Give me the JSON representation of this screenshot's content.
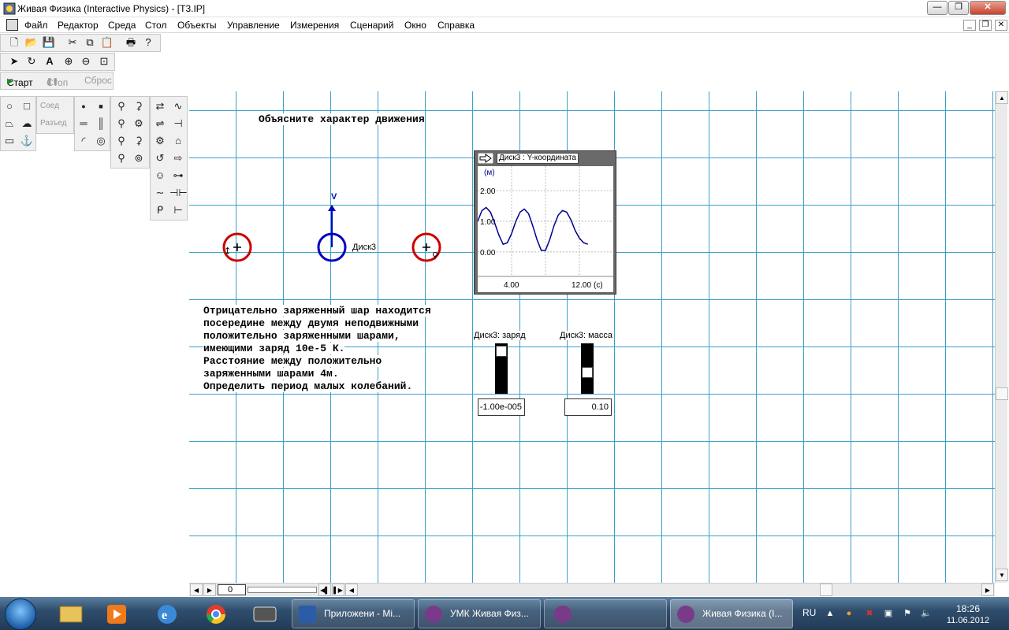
{
  "window": {
    "title": "Живая Физика (Interactive Physics) - [T3.IP]",
    "minimize_label": "—",
    "maximize_label": "❐",
    "close_label": "✕"
  },
  "menu": {
    "items": [
      "Файл",
      "Редактор",
      "Среда",
      "Стол",
      "Объекты",
      "Управление",
      "Измерения",
      "Сценарий",
      "Окно",
      "Справка"
    ],
    "mdi_minimize": "_",
    "mdi_restore": "❐",
    "mdi_close": "✕"
  },
  "toolbar": {
    "icons": [
      "new-file-icon",
      "open-file-icon",
      "save-icon",
      "cut-icon",
      "copy-icon",
      "paste-icon",
      "print-icon",
      "help-icon"
    ]
  },
  "tools": {
    "icons": [
      "arrow-select-icon",
      "rotate-icon",
      "text-tool-icon",
      "zoom-in-icon",
      "zoom-out-icon",
      "zoom-fit-icon"
    ],
    "text_glyph": "A"
  },
  "run": {
    "start_label": "Старт",
    "stop_label": "Стоп",
    "reset_label": "Сброс"
  },
  "palette": {
    "join_label": "Соед",
    "split_label": "Разъед"
  },
  "workspace": {
    "heading": "Объясните характер движения",
    "problem_lines": [
      "Отрицательно заряженный шар находится",
      "посередине между двумя неподвижными",
      "положительно заряженными шарами,",
      "имеющими заряд 10е-5 К.",
      "Расстояние между положительно",
      "заряженными шарами 4м.",
      "Определить период малых колебаний."
    ],
    "disk_label": "Диск3",
    "velocity_label": "V",
    "colors": {
      "charged_ball": "#cc0000",
      "moving_disk": "#0000c0",
      "grid": "#3aa0c8"
    }
  },
  "graph": {
    "title": "Диск3 : Y-координата",
    "unit_y": "(м)",
    "unit_x": "(с)",
    "y_ticks": [
      "2.00",
      "1.00",
      "0.00"
    ],
    "x_ticks": [
      "4.00",
      "12.00"
    ]
  },
  "chart_data": {
    "type": "line",
    "ylabel": "(м)",
    "xlabel": "(с)",
    "ylim": [
      -0.8,
      2.8
    ],
    "xlim": [
      0,
      16
    ],
    "series": [
      {
        "x": [
          0,
          0.5,
          1,
          1.5,
          2,
          2.5,
          3,
          3.5,
          4,
          4.5,
          5,
          5.5,
          6,
          6.5,
          7,
          7.5,
          8,
          8.5,
          9,
          9.5,
          10,
          10.5,
          11,
          11.5,
          12,
          12.5,
          13
        ],
        "y": [
          1.0,
          1.35,
          1.45,
          1.3,
          0.95,
          0.55,
          0.25,
          0.3,
          0.6,
          1.0,
          1.3,
          1.4,
          1.25,
          0.85,
          0.4,
          0.05,
          0.05,
          0.4,
          0.85,
          1.2,
          1.35,
          1.3,
          1.05,
          0.7,
          0.45,
          0.3,
          0.25
        ]
      }
    ],
    "color": "#000090",
    "grid": true
  },
  "sliders": {
    "charge_label": "Диск3: заряд",
    "charge_value": "-1.00e-005",
    "charge_level": 0.95,
    "mass_label": "Диск3: масса",
    "mass_value": "0.10",
    "mass_level": 0.4
  },
  "hscroll": {
    "frame_value": "0"
  },
  "taskbar": {
    "tasks": [
      "Приложени - Mi...",
      "УМК Живая Физ...",
      "",
      "Живая Физика (I..."
    ],
    "lang": "RU",
    "time": "18:26",
    "date": "11.06.2012"
  }
}
